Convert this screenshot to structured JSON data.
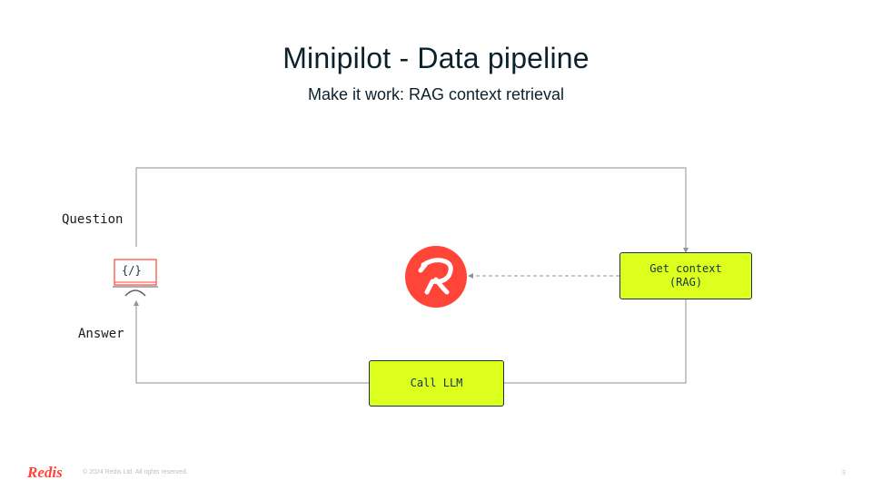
{
  "title": "Minipilot - Data pipeline",
  "subtitle": "Make it work: RAG context retrieval",
  "labels": {
    "question": "Question",
    "answer": "Answer"
  },
  "client_icon_text": "{/}",
  "nodes": {
    "get_context": "Get context\n(RAG)",
    "call_llm": "Call LLM"
  },
  "footer": {
    "logo": "Redis",
    "copyright": "© 2024 Redis Ltd. All rights reserved.",
    "page": "3"
  },
  "colors": {
    "brand_red": "#ff4438",
    "node_fill": "#dcff1e",
    "node_border": "#163341",
    "line": "#8a9499"
  }
}
